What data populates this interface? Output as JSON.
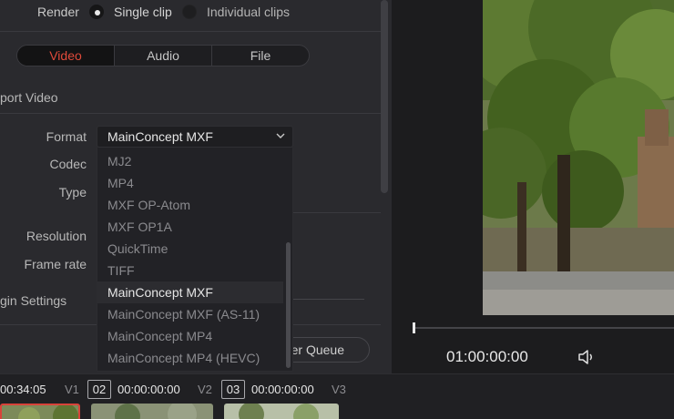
{
  "render": {
    "label": "Render",
    "options": [
      {
        "label": "Single clip",
        "selected": true
      },
      {
        "label": "Individual clips",
        "selected": false
      }
    ]
  },
  "tabs": [
    {
      "label": "Video",
      "active": true
    },
    {
      "label": "Audio",
      "active": false
    },
    {
      "label": "File",
      "active": false
    }
  ],
  "section_export_video": "port Video",
  "fields": {
    "format_label": "Format",
    "codec_label": "Codec",
    "type_label": "Type",
    "resolution_label": "Resolution",
    "framerate_label": "Frame rate"
  },
  "format_select": {
    "value": "MainConcept MXF",
    "options": [
      "MJ2",
      "MP4",
      "MXF OP-Atom",
      "MXF OP1A",
      "QuickTime",
      "TIFF",
      "MainConcept MXF",
      "MainConcept MXF (AS-11)",
      "MainConcept MP4",
      "MainConcept MP4 (HEVC)"
    ],
    "selected_index": 6
  },
  "section_plugin_settings": "gin Settings",
  "queue_button": "er Queue",
  "viewer": {
    "timecode": "01:00:00:00",
    "icons": [
      "speaker-icon"
    ]
  },
  "timeline": {
    "clips": [
      {
        "number": "",
        "timecode": "00:34:05",
        "track": "V1"
      },
      {
        "number": "02",
        "timecode": "00:00:00:00",
        "track": "V2"
      },
      {
        "number": "03",
        "timecode": "00:00:00:00",
        "track": "V3"
      }
    ]
  },
  "colors": {
    "accent": "#e04a3a",
    "panel": "#2a2a2e",
    "background": "#1b1b1d"
  }
}
